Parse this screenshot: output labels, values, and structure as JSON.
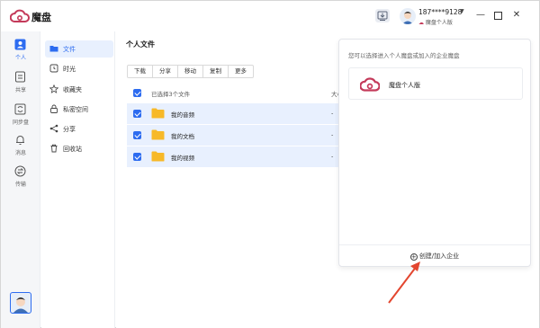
{
  "app": {
    "name": "魔盘"
  },
  "user": {
    "phone": "187****9128",
    "edition": "魔盘个人版"
  },
  "rail": [
    {
      "label": "个人",
      "icon": "person-icon",
      "active": true
    },
    {
      "label": "共享",
      "icon": "share-doc-icon",
      "active": false
    },
    {
      "label": "同步盘",
      "icon": "sync-icon",
      "active": false
    },
    {
      "label": "消息",
      "icon": "bell-icon",
      "active": false
    },
    {
      "label": "传输",
      "icon": "transfer-icon",
      "active": false
    }
  ],
  "sidebar": [
    {
      "label": "文件",
      "icon": "folder-icon",
      "active": true
    },
    {
      "label": "时光",
      "icon": "clock-icon",
      "active": false
    },
    {
      "label": "收藏夹",
      "icon": "star-icon",
      "active": false
    },
    {
      "label": "私密空间",
      "icon": "lock-icon",
      "active": false
    },
    {
      "label": "分享",
      "icon": "share-icon",
      "active": false
    },
    {
      "label": "回收站",
      "icon": "trash-icon",
      "active": false
    }
  ],
  "main": {
    "title": "个人文件",
    "toolbar": [
      "下载",
      "分享",
      "移动",
      "复制",
      "更多"
    ],
    "selected_text": "已选择3个文件",
    "size_header": "大小",
    "files": [
      {
        "name": "我的音频",
        "size": "-"
      },
      {
        "name": "我的文档",
        "size": "-"
      },
      {
        "name": "我的视频",
        "size": "-"
      }
    ]
  },
  "popup": {
    "description": "您可以选择进入个人魔盘或加入的企业魔盘",
    "card_label": "魔盘个人版",
    "create_link": "创建/加入企业"
  },
  "colors": {
    "accent": "#2d6cf0",
    "brand": "#c43a5a",
    "folder": "#f7b928",
    "arrow": "#e3462f"
  }
}
